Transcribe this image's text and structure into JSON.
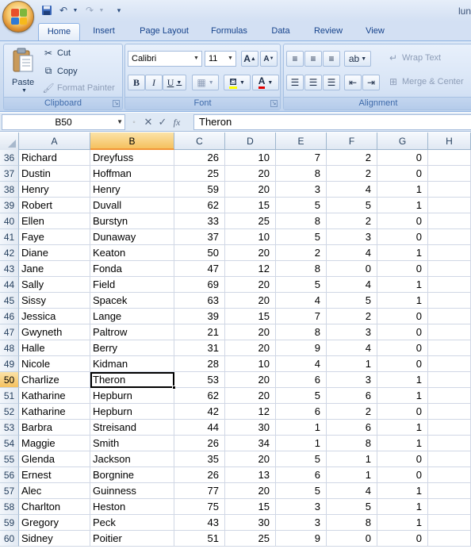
{
  "title": {
    "text": "lun"
  },
  "qat": {
    "more": "▾"
  },
  "tabs": [
    "Home",
    "Insert",
    "Page Layout",
    "Formulas",
    "Data",
    "Review",
    "View"
  ],
  "clipboard": {
    "paste": "Paste",
    "cut": "Cut",
    "copy": "Copy",
    "format_painter": "Format Painter",
    "label": "Clipboard"
  },
  "font": {
    "name": "Calibri",
    "size": "11",
    "label": "Font",
    "grow": "A",
    "shrink": "A",
    "bold": "B",
    "italic": "I",
    "underline": "U",
    "font_color_letter": "A",
    "font_color": "#e00000"
  },
  "alignment": {
    "wrap_text": "Wrap Text",
    "merge_center": "Merge & Center",
    "label": "Alignment"
  },
  "formula_bar": {
    "name_box": "B50",
    "fx": "fx",
    "content": "Theron"
  },
  "sheet": {
    "columns": [
      "A",
      "B",
      "C",
      "D",
      "E",
      "F",
      "G",
      "H"
    ],
    "selected_column": "B",
    "selected_row": "50",
    "active_cell": "B50",
    "rows": [
      {
        "n": "36",
        "a": "Richard",
        "b": "Dreyfuss",
        "c": "26",
        "d": "10",
        "e": "7",
        "f": "2",
        "g": "0"
      },
      {
        "n": "37",
        "a": "Dustin",
        "b": "Hoffman",
        "c": "25",
        "d": "20",
        "e": "8",
        "f": "2",
        "g": "0"
      },
      {
        "n": "38",
        "a": "Henry",
        "b": "Henry",
        "c": "59",
        "d": "20",
        "e": "3",
        "f": "4",
        "g": "1"
      },
      {
        "n": "39",
        "a": "Robert",
        "b": "Duvall",
        "c": "62",
        "d": "15",
        "e": "5",
        "f": "5",
        "g": "1"
      },
      {
        "n": "40",
        "a": "Ellen",
        "b": "Burstyn",
        "c": "33",
        "d": "25",
        "e": "8",
        "f": "2",
        "g": "0"
      },
      {
        "n": "41",
        "a": "Faye",
        "b": "Dunaway",
        "c": "37",
        "d": "10",
        "e": "5",
        "f": "3",
        "g": "0"
      },
      {
        "n": "42",
        "a": "Diane",
        "b": "Keaton",
        "c": "50",
        "d": "20",
        "e": "2",
        "f": "4",
        "g": "1"
      },
      {
        "n": "43",
        "a": "Jane",
        "b": "Fonda",
        "c": "47",
        "d": "12",
        "e": "8",
        "f": "0",
        "g": "0"
      },
      {
        "n": "44",
        "a": "Sally",
        "b": "Field",
        "c": "69",
        "d": "20",
        "e": "5",
        "f": "4",
        "g": "1"
      },
      {
        "n": "45",
        "a": "Sissy",
        "b": "Spacek",
        "c": "63",
        "d": "20",
        "e": "4",
        "f": "5",
        "g": "1"
      },
      {
        "n": "46",
        "a": "Jessica",
        "b": "Lange",
        "c": "39",
        "d": "15",
        "e": "7",
        "f": "2",
        "g": "0"
      },
      {
        "n": "47",
        "a": "Gwyneth",
        "b": "Paltrow",
        "c": "21",
        "d": "20",
        "e": "8",
        "f": "3",
        "g": "0"
      },
      {
        "n": "48",
        "a": "Halle",
        "b": "Berry",
        "c": "31",
        "d": "20",
        "e": "9",
        "f": "4",
        "g": "0"
      },
      {
        "n": "49",
        "a": "Nicole",
        "b": "Kidman",
        "c": "28",
        "d": "10",
        "e": "4",
        "f": "1",
        "g": "0"
      },
      {
        "n": "50",
        "a": "Charlize",
        "b": "Theron",
        "c": "53",
        "d": "20",
        "e": "6",
        "f": "3",
        "g": "1"
      },
      {
        "n": "51",
        "a": "Katharine",
        "b": "Hepburn",
        "c": "62",
        "d": "20",
        "e": "5",
        "f": "6",
        "g": "1"
      },
      {
        "n": "52",
        "a": "Katharine",
        "b": "Hepburn",
        "c": "42",
        "d": "12",
        "e": "6",
        "f": "2",
        "g": "0"
      },
      {
        "n": "53",
        "a": "Barbra",
        "b": "Streisand",
        "c": "44",
        "d": "30",
        "e": "1",
        "f": "6",
        "g": "1"
      },
      {
        "n": "54",
        "a": "Maggie",
        "b": "Smith",
        "c": "26",
        "d": "34",
        "e": "1",
        "f": "8",
        "g": "1"
      },
      {
        "n": "55",
        "a": "Glenda",
        "b": "Jackson",
        "c": "35",
        "d": "20",
        "e": "5",
        "f": "1",
        "g": "0"
      },
      {
        "n": "56",
        "a": "Ernest",
        "b": "Borgnine",
        "c": "26",
        "d": "13",
        "e": "6",
        "f": "1",
        "g": "0"
      },
      {
        "n": "57",
        "a": "Alec",
        "b": "Guinness",
        "c": "77",
        "d": "20",
        "e": "5",
        "f": "4",
        "g": "1"
      },
      {
        "n": "58",
        "a": "Charlton",
        "b": "Heston",
        "c": "75",
        "d": "15",
        "e": "3",
        "f": "5",
        "g": "1"
      },
      {
        "n": "59",
        "a": "Gregory",
        "b": "Peck",
        "c": "43",
        "d": "30",
        "e": "3",
        "f": "8",
        "g": "1"
      },
      {
        "n": "60",
        "a": "Sidney",
        "b": "Poitier",
        "c": "51",
        "d": "25",
        "e": "9",
        "f": "0",
        "g": "0"
      }
    ]
  }
}
